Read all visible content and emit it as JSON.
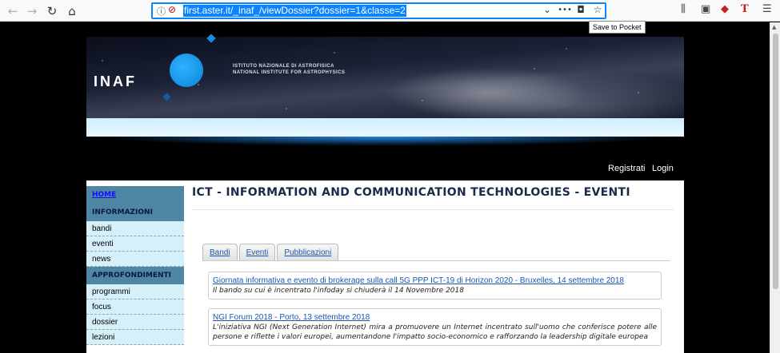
{
  "browser": {
    "url": "first.aster.it/_inaf_/viewDossier?dossier=1&classe=2",
    "pocket_tooltip": "Save to Pocket",
    "icons": {
      "back": "arrow-left-icon",
      "forward": "arrow-right-icon",
      "reload": "reload-icon",
      "home": "home-icon",
      "info": "info-icon",
      "tracking": "tracking-protection-icon",
      "dropdown": "chevron-down-icon",
      "more": "more-icon",
      "pocket": "pocket-icon",
      "bookmark": "star-icon",
      "library": "library-icon",
      "sidebar": "sidebar-icon",
      "extension": "extension-icon",
      "toolbar_t": "t-extension-icon",
      "menu": "hamburger-menu-icon"
    },
    "glyphs": {
      "back": "←",
      "forward": "→",
      "reload": "↻",
      "home": "⌂",
      "info": "ⓘ",
      "tracking": "⊘",
      "dropdown": "⌄",
      "more": "•••",
      "pocket": "◘",
      "bookmark": "☆",
      "library": "⫼",
      "sidebar": "▣",
      "extension": "◆",
      "toolbar_t": "T",
      "menu": "☰",
      "scroll_up": "▲"
    }
  },
  "banner": {
    "logo": "INAF",
    "institute_line1": "ISTITUTO NAZIONALE DI ASTROFISICA",
    "institute_line2": "NATIONAL INSTITUTE FOR ASTROPHYSICS"
  },
  "auth": {
    "register": "Registrati",
    "login": "Login"
  },
  "sidebar": {
    "home": "HOME",
    "section1": "INFORMAZIONI",
    "section1_items": [
      "bandi",
      "eventi",
      "news"
    ],
    "section2": "APPROFONDIMENTI",
    "section2_items": [
      "programmi",
      "focus",
      "dossier",
      "lezioni"
    ]
  },
  "main": {
    "title": "ICT - INFORMATION AND COMMUNICATION TECHNOLOGIES - EVENTI",
    "tabs": [
      "Bandi",
      "Eventi",
      "Pubblicazioni"
    ],
    "events": [
      {
        "title": "Giornata informativa e evento di brokerage sulla call 5G PPP ICT-19 di Horizon 2020 - Bruxelles, 14 settembre 2018",
        "desc": "Il bando su cui è incentrato l'infoday si chiuderà il 14 Novembre 2018"
      },
      {
        "title": "NGI Forum 2018 - Porto, 13 settembre 2018",
        "desc": "L'iniziativa NGI (Next Generation Internet) mira a promuovere un Internet incentrato sull'uomo che conferisce potere alle persone e riflette i valori europei, aumentandone l'impatto socio-economico e rafforzando la leadership digitale europea"
      }
    ]
  },
  "colors": {
    "accent": "#0a84ff",
    "link": "#1a56b0",
    "sidebar_head": "#4f86a3",
    "sidebar_item": "#d6f0fa"
  }
}
